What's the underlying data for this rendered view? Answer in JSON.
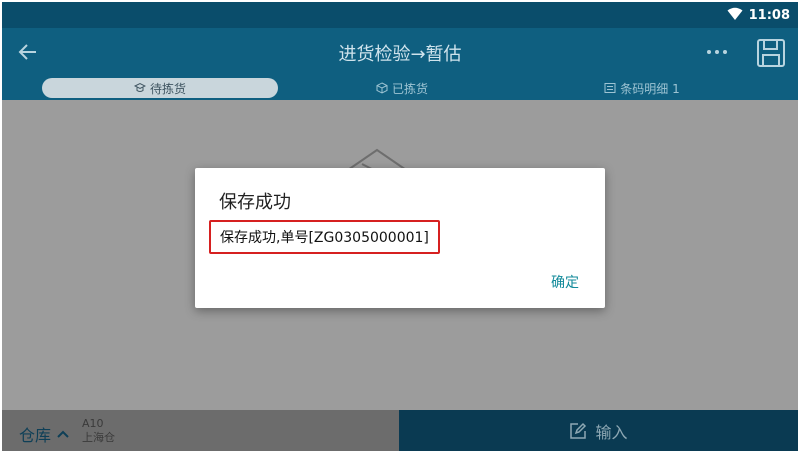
{
  "status_bar": {
    "time": "11:08",
    "wifi_icon": "wifi-icon"
  },
  "app_bar": {
    "title": "进货检验→暂估",
    "back_icon": "arrow-left-icon",
    "more_icon": "more-horizontal-icon",
    "save_icon": "floppy-disk-icon"
  },
  "tabs": [
    {
      "label": "待拣货",
      "icon": "mortarboard-icon",
      "active": true
    },
    {
      "label": "已拣货",
      "icon": "cube-icon",
      "active": false
    },
    {
      "label": "条码明细 1",
      "icon": "list-icon",
      "active": false
    }
  ],
  "dialog": {
    "title": "保存成功",
    "message": "保存成功,单号[ZG0305000001]",
    "ok_label": "确定",
    "highlight_color": "#d62020"
  },
  "bottom_bar": {
    "warehouse_label": "仓库",
    "warehouse_code": "A10",
    "warehouse_name": "上海仓",
    "input_label": "输入",
    "input_icon": "edit-icon"
  },
  "colors": {
    "primary": "#0f5f80",
    "status_bar": "#0a4d6b",
    "accent": "#128a9a"
  }
}
